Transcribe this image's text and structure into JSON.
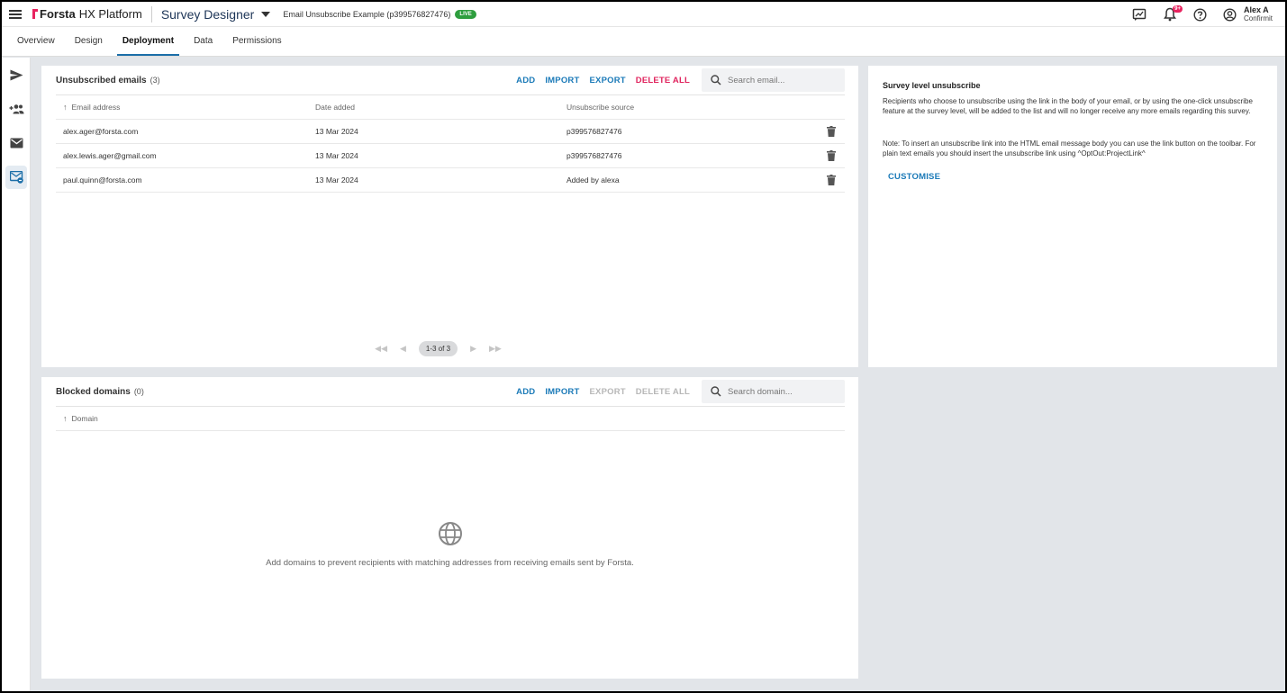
{
  "header": {
    "brand": "Forsta",
    "product": "HX Platform",
    "app_title": "Survey Designer",
    "project": "Email Unsubscribe Example (p399576827476)",
    "live_badge": "LIVE",
    "notifications_badge": "9+",
    "user_name": "Alex A",
    "user_org": "Confirmit"
  },
  "tabs": [
    {
      "label": "Overview"
    },
    {
      "label": "Design"
    },
    {
      "label": "Deployment"
    },
    {
      "label": "Data"
    },
    {
      "label": "Permissions"
    }
  ],
  "unsubscribed": {
    "title": "Unsubscribed emails",
    "count": "(3)",
    "actions": {
      "add": "ADD",
      "import": "IMPORT",
      "export": "EXPORT",
      "delete_all": "DELETE ALL"
    },
    "search_placeholder": "Search email...",
    "columns": {
      "email": "Email address",
      "date": "Date added",
      "source": "Unsubscribe source"
    },
    "rows": [
      {
        "email": "alex.ager@forsta.com",
        "date": "13 Mar 2024",
        "source": "p399576827476"
      },
      {
        "email": "alex.lewis.ager@gmail.com",
        "date": "13 Mar 2024",
        "source": "p399576827476"
      },
      {
        "email": "paul.quinn@forsta.com",
        "date": "13 Mar 2024",
        "source": "Added by alexa"
      }
    ],
    "pager_label": "1-3 of 3"
  },
  "blocked": {
    "title": "Blocked domains",
    "count": "(0)",
    "actions": {
      "add": "ADD",
      "import": "IMPORT",
      "export": "EXPORT",
      "delete_all": "DELETE ALL"
    },
    "search_placeholder": "Search domain...",
    "columns": {
      "domain": "Domain"
    },
    "empty_text": "Add domains to prevent recipients with matching addresses from receiving emails sent by Forsta."
  },
  "info": {
    "title": "Survey level unsubscribe",
    "paragraph1": "Recipients who choose to unsubscribe using the link in the body of your email, or by using the one-click unsubscribe feature at the survey level, will be added to the list and will no longer receive any more emails regarding this survey.",
    "paragraph2": "Note: To insert an unsubscribe link into the HTML email message body you can use the link button on the toolbar. For plain text emails you should insert the unsubscribe link using ^OptOut:ProjectLink^",
    "customise_label": "CUSTOMISE"
  },
  "colors": {
    "accent": "#1b7ab8",
    "danger": "#e0245e",
    "live": "#2e9e3e",
    "brand": "#e8235f"
  }
}
